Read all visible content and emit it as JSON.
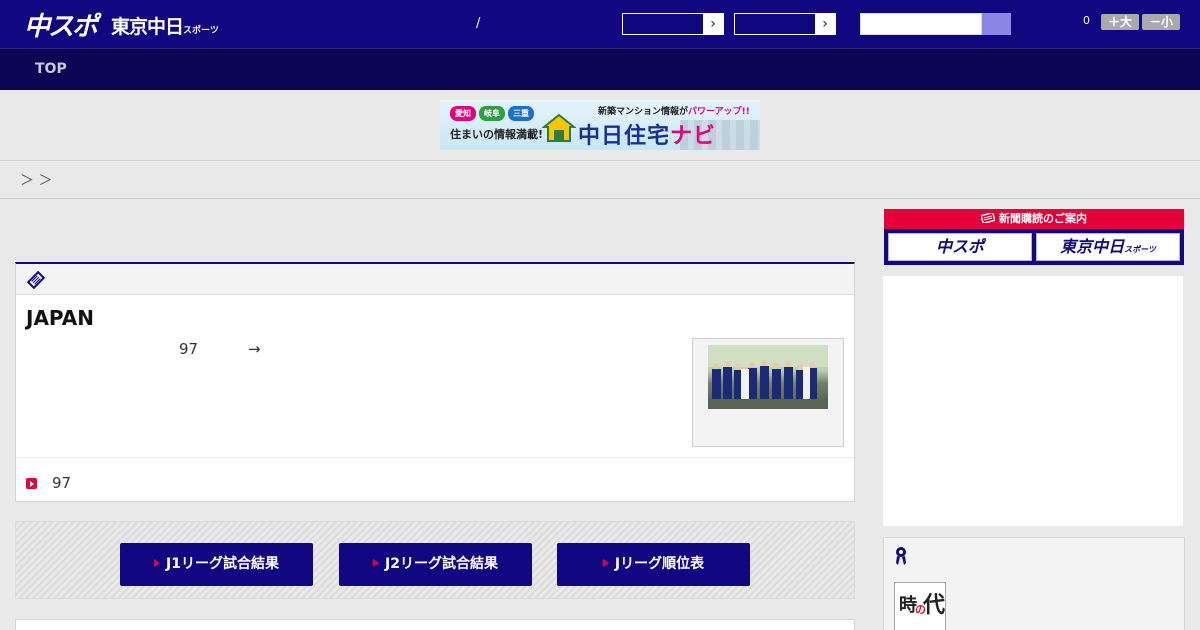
{
  "header": {
    "logo_main": "中スポ",
    "logo_sub": "東京中日",
    "logo_sub_small": "スポーツ",
    "separator": "/",
    "select_arrow": "›",
    "font_size_count": "0",
    "font_increase": "＋大",
    "font_decrease": "－小"
  },
  "nav": {
    "top_label": "TOP"
  },
  "banner": {
    "tags": [
      "愛知",
      "岐阜",
      "三重"
    ],
    "tagline": "住まいの情報満載!",
    "top_text": "新築マンション情報が",
    "top_highlight": "パワーアップ!!",
    "brand": "中日住宅",
    "brand_highlight": "ナビ"
  },
  "breadcrumb": {
    "text": "＞ ＞"
  },
  "article": {
    "title": "JAPAN",
    "text": "97",
    "arrow": "→",
    "footer_text": "97"
  },
  "league": {
    "buttons": [
      "J1リーグ試合結果",
      "J2リーグ試合結果",
      "Jリーグ順位表"
    ]
  },
  "sidebar": {
    "subscribe_title": "新聞購読のご案内",
    "subscribe_left": "中スポ",
    "subscribe_right": "東京中日",
    "subscribe_right_small": "スポーツ",
    "rank_thumb": [
      "時",
      "の",
      "代"
    ]
  },
  "colors": {
    "header_bg": "#110780",
    "nav_bg": "#0c0556",
    "accent_red": "#e50039",
    "search_button": "#8b86e6"
  }
}
